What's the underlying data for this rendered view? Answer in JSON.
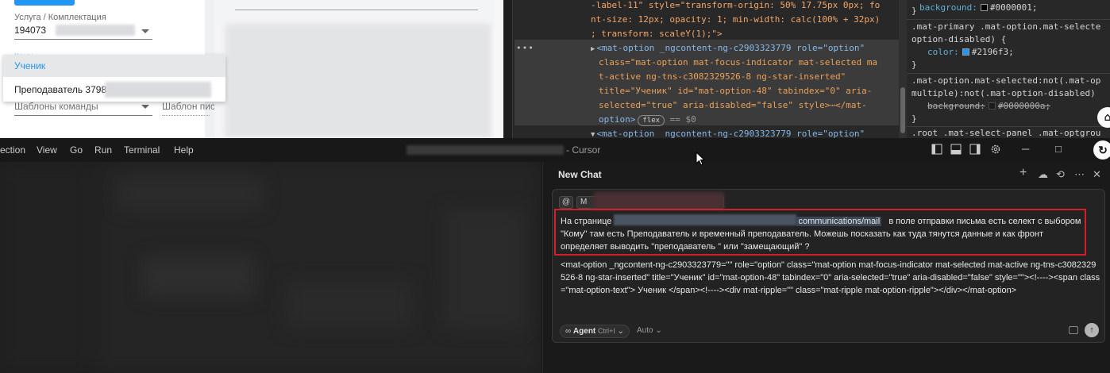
{
  "browser": {
    "field_label": "Услуга / Комплектация",
    "field_value": "194073",
    "ghost_label": "Кому",
    "dropdown_options": [
      "Ученик",
      "Преподаватель 3798"
    ],
    "templates_team": "Шаблоны команды",
    "templates_single": "Шаблон пис"
  },
  "devtools": {
    "lines": [
      {
        "text": "-label-11\" style=\"transform-origin: 50% 17.75px 0px; fo"
      },
      {
        "text": "nt-size: 12px; opacity: 1; min-width: calc(100% + 32px)"
      },
      {
        "text": "; transform: scaleY(1);\">"
      },
      {
        "text": "<mat-option _ngcontent-ng-c2903323779 role=\"option\""
      },
      {
        "text": "class=\"mat-option mat-focus-indicator mat-selected ma"
      },
      {
        "text": "t-active ng-tns-c3082329526-8 ng-star-inserted\""
      },
      {
        "text": "title=\"Ученик\" id=\"mat-option-48\" tabindex=\"0\" aria-"
      },
      {
        "text": "selected=\"true\" aria-disabled=\"false\" style>⋯</mat-"
      },
      {
        "text": "option>"
      },
      {
        "text": "<mat-option _ngcontent-ng-c2903323779 role=\"option\""
      }
    ],
    "flex_badge": "flex",
    "dollar_zero": "== $0",
    "styles": {
      "line0_prop": "background:",
      "line0_val": "#0000001;",
      "brace1": "}",
      "sel2a": ".mat-primary .mat-option.mat-selecte",
      "sel2b": "option-disabled) {",
      "prop2": "color:",
      "val2": "#2196f3;",
      "brace2": "}",
      "sel3a": ".mat-option.mat-selected:not(.mat-op",
      "sel3b": "multiple):not(.mat-option-disabled)",
      "prop3": "background:",
      "val3": "#0000000a;",
      "brace3": "}",
      "sel4": ".root .mat-select-panel .mat-optgrou",
      "color_primary": "#2196f3"
    },
    "fab_home": "⌂",
    "fab_refresh": "↻"
  },
  "ide": {
    "menu": [
      "ection",
      "View",
      "Go",
      "Run",
      "Terminal",
      "Help"
    ],
    "title_suffix": "- Cursor",
    "window_controls": {
      "minimize": "─",
      "maximize": "□",
      "close": "✕"
    }
  },
  "chat": {
    "title": "New Chat",
    "header_icons": {
      "add": "+",
      "cloud": "☁",
      "history": "⟲",
      "more": "⋯",
      "close": "✕"
    },
    "chip_at": "@",
    "chip_ctx_label": "M",
    "message_pre": "На странице",
    "message_url_visible": "communications/mail",
    "message_post": "в поле отправки письма есть селект с выбором \"Кому\" там есть Преподаватель и временный преподаватель. Можешь посказать как туда тянутся данные и как фронт определяет выводить \"преподаватель \" или \"замещающий\" ?",
    "code_paste": "<mat-option _ngcontent-ng-c2903323779=\"\" role=\"option\" class=\"mat-option mat-focus-indicator mat-selected mat-active ng-tns-c3082329526-8 ng-star-inserted\" title=\"Ученик\" id=\"mat-option-48\" tabindex=\"0\" aria-selected=\"true\" aria-disabled=\"false\" style=\"\"><!----><span class=\"mat-option-text\"> Ученик </span><!----><div mat-ripple=\"\" class=\"mat-ripple mat-option-ripple\"></div></mat-option>",
    "agent_label": "Agent",
    "agent_shortcut": "Ctrl+I",
    "model_label": "Auto",
    "send_icon": "↑"
  }
}
